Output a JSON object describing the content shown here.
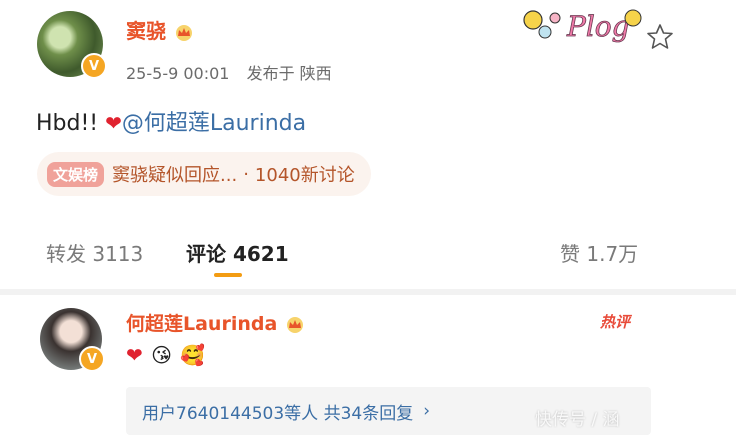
{
  "post": {
    "username": "窦骁",
    "date": "25-5-9 00:01",
    "location_label": "发布于 陕西",
    "text_prefix": "Hbd!! ",
    "text_mention": "@何超莲Laurinda"
  },
  "topic": {
    "badge": "文娱榜",
    "text": "窦骁疑似回应...",
    "separator": "·",
    "discussions": "1040新讨论"
  },
  "tabs": {
    "repost": "转发 3113",
    "comments": "评论 4621",
    "likes": "赞 1.7万"
  },
  "comment": {
    "username": "何超莲Laurinda",
    "hot_label": "热评",
    "replies_text": "用户7640144503等人  共34条回复",
    "replies_chevron": "›"
  },
  "sticker_text": "Plog",
  "watermark": "快传号 / 涵",
  "colors": {
    "username": "#e8542a",
    "mention": "#3b6ea5",
    "tab_underline": "#f39c12",
    "verified": "#f5a623"
  },
  "icons": [
    "crown-icon",
    "verified-icon",
    "star-icon",
    "heart-icon",
    "chevron-right-icon"
  ]
}
